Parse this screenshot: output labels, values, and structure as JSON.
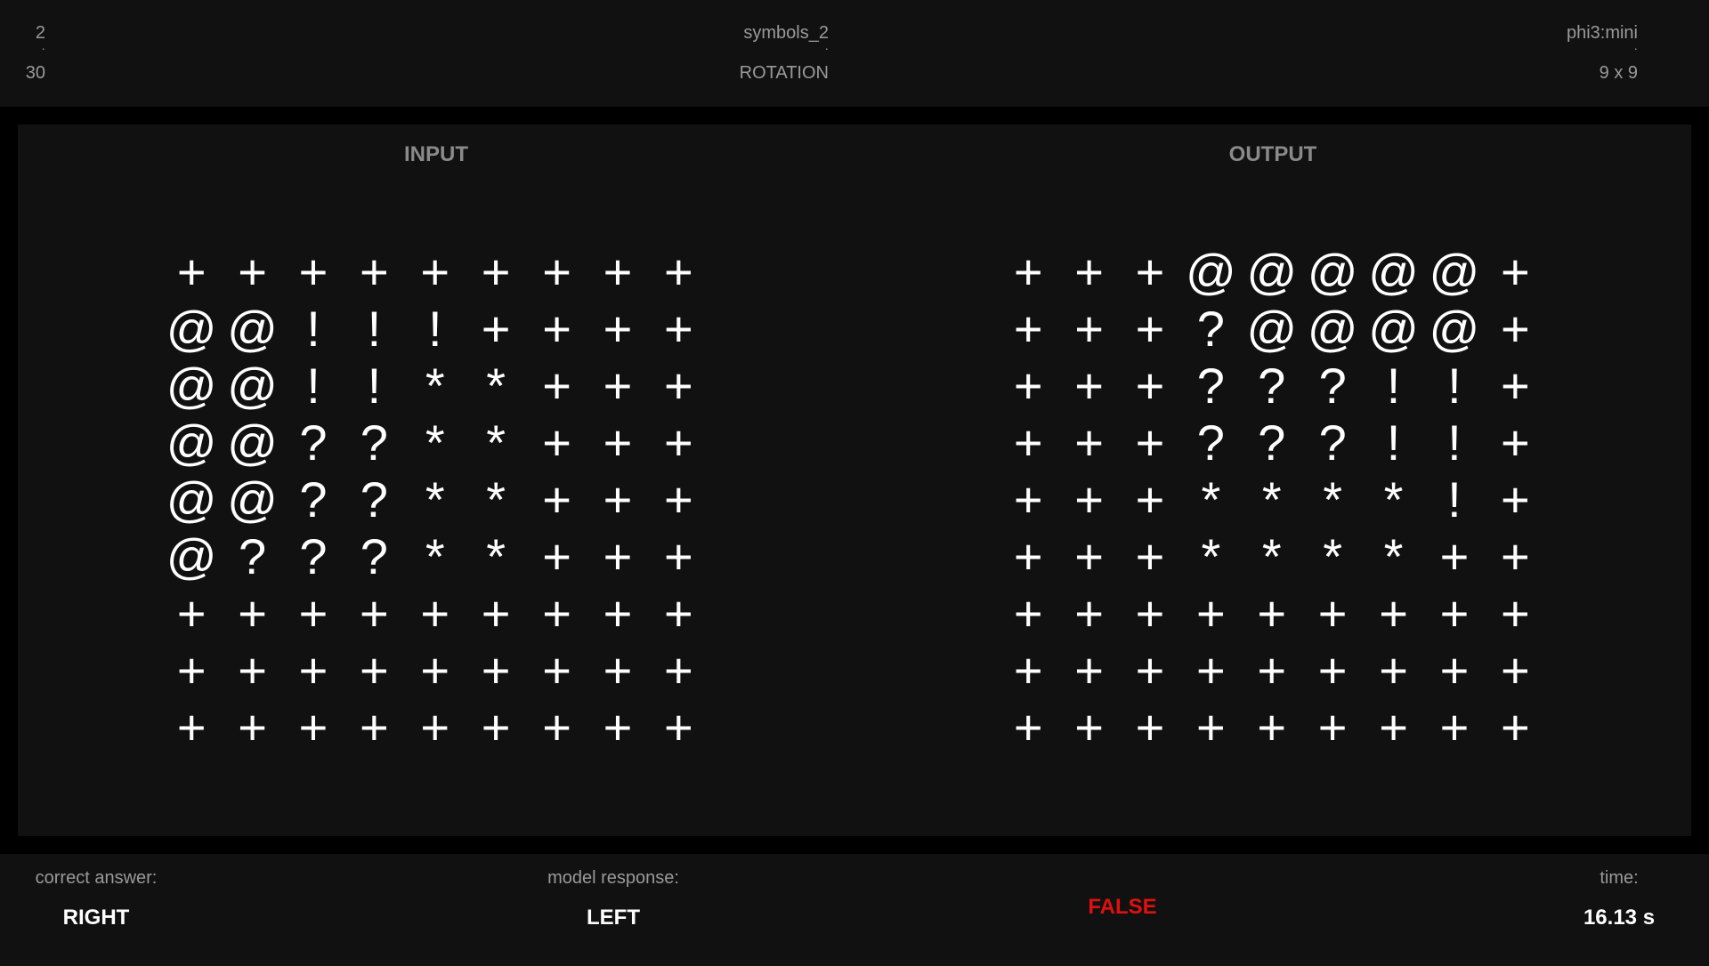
{
  "header": {
    "left": {
      "top": "2",
      "dot": "·",
      "bottom": "30"
    },
    "center": {
      "top": "symbols_2",
      "dot": "·",
      "bottom": "ROTATION"
    },
    "right": {
      "top": "phi3:mini",
      "dot": "·",
      "bottom": "9 x 9"
    }
  },
  "input": {
    "title": "INPUT",
    "rows": [
      [
        "+",
        "+",
        "+",
        "+",
        "+",
        "+",
        "+",
        "+",
        "+"
      ],
      [
        "@",
        "@",
        "!",
        "!",
        "!",
        "+",
        "+",
        "+",
        "+"
      ],
      [
        "@",
        "@",
        "!",
        "!",
        "*",
        "*",
        "+",
        "+",
        "+"
      ],
      [
        "@",
        "@",
        "?",
        "?",
        "*",
        "*",
        "+",
        "+",
        "+"
      ],
      [
        "@",
        "@",
        "?",
        "?",
        "*",
        "*",
        "+",
        "+",
        "+"
      ],
      [
        "@",
        "?",
        "?",
        "?",
        "*",
        "*",
        "+",
        "+",
        "+"
      ],
      [
        "+",
        "+",
        "+",
        "+",
        "+",
        "+",
        "+",
        "+",
        "+"
      ],
      [
        "+",
        "+",
        "+",
        "+",
        "+",
        "+",
        "+",
        "+",
        "+"
      ],
      [
        "+",
        "+",
        "+",
        "+",
        "+",
        "+",
        "+",
        "+",
        "+"
      ]
    ]
  },
  "output": {
    "title": "OUTPUT",
    "rows": [
      [
        "+",
        "+",
        "+",
        "@",
        "@",
        "@",
        "@",
        "@",
        "+"
      ],
      [
        "+",
        "+",
        "+",
        "?",
        "@",
        "@",
        "@",
        "@",
        "+"
      ],
      [
        "+",
        "+",
        "+",
        "?",
        "?",
        "?",
        "!",
        "!",
        "+"
      ],
      [
        "+",
        "+",
        "+",
        "?",
        "?",
        "?",
        "!",
        "!",
        "+"
      ],
      [
        "+",
        "+",
        "+",
        "*",
        "*",
        "*",
        "*",
        "!",
        "+"
      ],
      [
        "+",
        "+",
        "+",
        "*",
        "*",
        "*",
        "*",
        "+",
        "+"
      ],
      [
        "+",
        "+",
        "+",
        "+",
        "+",
        "+",
        "+",
        "+",
        "+"
      ],
      [
        "+",
        "+",
        "+",
        "+",
        "+",
        "+",
        "+",
        "+",
        "+"
      ],
      [
        "+",
        "+",
        "+",
        "+",
        "+",
        "+",
        "+",
        "+",
        "+"
      ]
    ]
  },
  "footer": {
    "correct_label": "correct answer:",
    "correct_value": "RIGHT",
    "model_label": "model response:",
    "model_value": "LEFT",
    "verdict": "FALSE",
    "verdict_color": "#e01010",
    "time_label": "time:",
    "time_value": "16.13 s"
  }
}
